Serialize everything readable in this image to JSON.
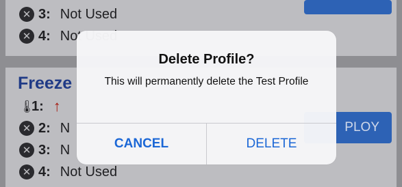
{
  "background": {
    "top_card": {
      "rows": [
        {
          "number": "3:",
          "text": "Not Used"
        },
        {
          "number": "4:",
          "text": "Not Used"
        }
      ],
      "button_label": ""
    },
    "freeze_card": {
      "title": "Freeze",
      "sensor_row": {
        "number": "1:"
      },
      "rows": [
        {
          "number": "2:",
          "text": "N"
        },
        {
          "number": "3:",
          "text": "N"
        },
        {
          "number": "4:",
          "text": "Not Used"
        }
      ],
      "deploy_label": "PLOY"
    },
    "icons": {
      "disabled": "x-circle-icon",
      "sensor": "thermometer-icon",
      "trend": "arrow-up-icon"
    },
    "colors": {
      "accent": "#1b67d6",
      "title": "#1f3a86",
      "arrow": "#a61a10"
    }
  },
  "alert": {
    "title": "Delete Profile?",
    "message": "This will permanently delete the Test Profile",
    "cancel_label": "CANCEL",
    "delete_label": "DELETE"
  }
}
